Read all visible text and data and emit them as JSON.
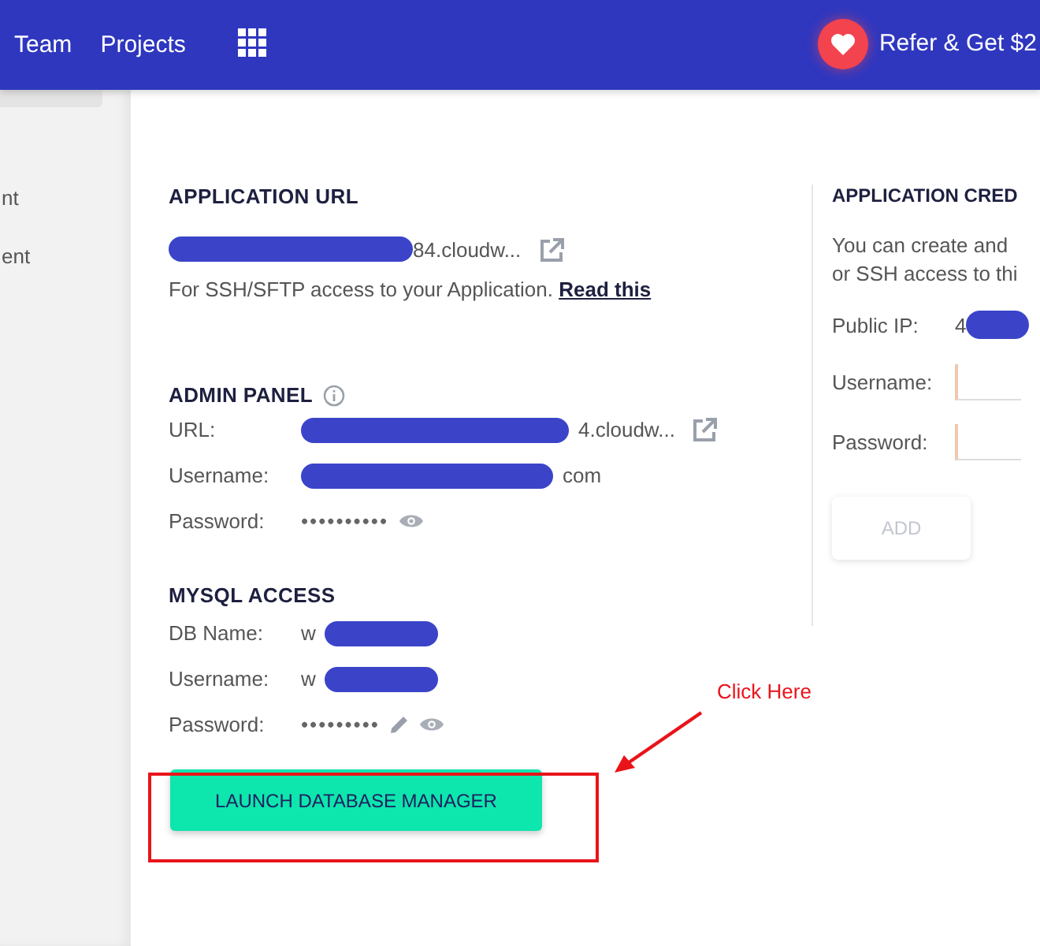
{
  "nav": {
    "links": [
      {
        "label": "Team"
      },
      {
        "label": "Projects"
      }
    ],
    "refer": "Refer & Get $2"
  },
  "sidebar": {
    "items": [
      {
        "label": "nt"
      },
      {
        "label": "ent"
      }
    ]
  },
  "app_url": {
    "title": "APPLICATION URL",
    "url": {
      "value": "84.cloudw...",
      "redacted_first": true
    },
    "ssh_text": "For SSH/SFTP access to your Application.",
    "ssh_link": "Read this"
  },
  "admin_panel": {
    "title": "ADMIN PANEL",
    "fields": [
      {
        "kind": "url",
        "label": "URL:",
        "value": "4.cloudw...",
        "redacted_first": true
      },
      {
        "kind": "text",
        "label": "Username:",
        "value": "com",
        "redacted_first": true
      },
      {
        "kind": "password",
        "label": "Password:",
        "value": "••••••••••",
        "editable": false
      }
    ]
  },
  "mysql": {
    "title": "MYSQL ACCESS",
    "fields": [
      {
        "kind": "text",
        "label": "DB Name:",
        "value": "w",
        "redacted_first": false
      },
      {
        "kind": "text",
        "label": "Username:",
        "value": "w",
        "redacted_first": false
      },
      {
        "kind": "password",
        "label": "Password:",
        "value": "•••••••••",
        "editable": true
      }
    ],
    "button": "LAUNCH DATABASE MANAGER"
  },
  "credentials": {
    "title": "APPLICATION CRED",
    "description": [
      "You can create and",
      "or SSH access to thi"
    ],
    "public_ip_label": "Public IP:",
    "public_ip": "4",
    "fields": [
      {
        "label": "Username:"
      },
      {
        "label": "Password:"
      }
    ],
    "button": "ADD",
    "button_disabled": true
  },
  "annotation": {
    "text": "Click Here"
  }
}
